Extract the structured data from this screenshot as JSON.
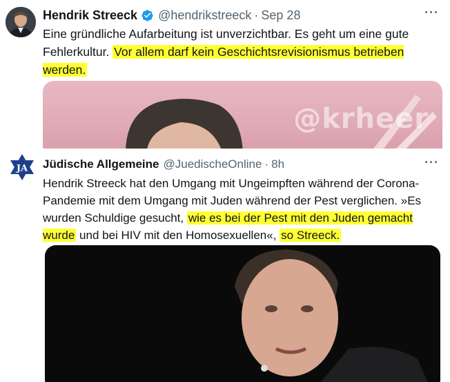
{
  "tweet1": {
    "name": "Hendrik Streeck",
    "handle": "@hendrikstreeck",
    "separator": "·",
    "time": "Sep 28",
    "more": "···",
    "text_plain": "Eine gründliche Aufarbeitung ist unverzichtbar. Es geht  um eine gute Fehlerkultur. ",
    "text_highlight": "Vor allem darf kein Geschichtsrevisionismus betrieben werden.",
    "media_watermark": "@krheer"
  },
  "tweet2": {
    "avatar_text": "JA",
    "name": "Jüdische Allgemeine",
    "handle": "@JuedischeOnline",
    "separator": "·",
    "time": "8h",
    "more": "···",
    "text_part1": "Hendrik Streeck hat den Umgang mit Ungeimpften während der Corona-Pandemie mit dem Umgang mit Juden während der Pest verglichen. »Es wurden Schuldige gesucht, ",
    "text_highlight1": "wie es bei der Pest mit den Juden gemacht wurde",
    "text_part2": " und bei HIV mit den Homosexuellen«, ",
    "text_highlight2": "so Streeck."
  },
  "colors": {
    "highlight": "#ffff33",
    "verified": "#1d9bf0",
    "secondary_text": "#536471",
    "ja_blue": "#1e3f8c"
  }
}
